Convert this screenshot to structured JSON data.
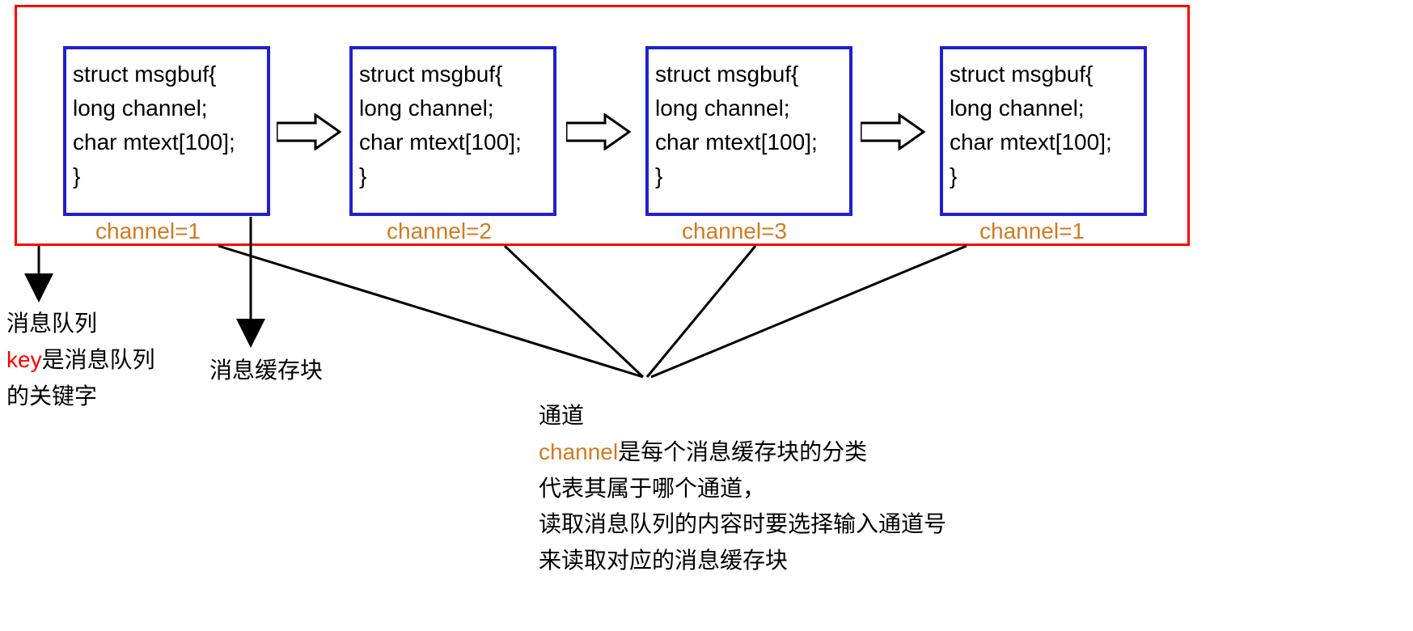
{
  "struct": {
    "line1": "struct msgbuf{",
    "line2": "long channel;",
    "line3": "char mtext[100];",
    "line4": "}"
  },
  "channels": {
    "c1": "channel=1",
    "c2": "channel=2",
    "c3": "channel=3",
    "c4": "channel=1"
  },
  "annotations": {
    "queue_l1": "消息队列",
    "queue_key": "key",
    "queue_l2_suffix": "是消息队列",
    "queue_l3": "的关键字",
    "block_label": "消息缓存块",
    "channel_l1": "通道",
    "channel_kw": "channel",
    "channel_l2_suffix": "是每个消息缓存块的分类",
    "channel_l3": "代表其属于哪个通道，",
    "channel_l4": "读取消息队列的内容时要选择输入通道号",
    "channel_l5": "来读取对应的消息缓存块"
  }
}
